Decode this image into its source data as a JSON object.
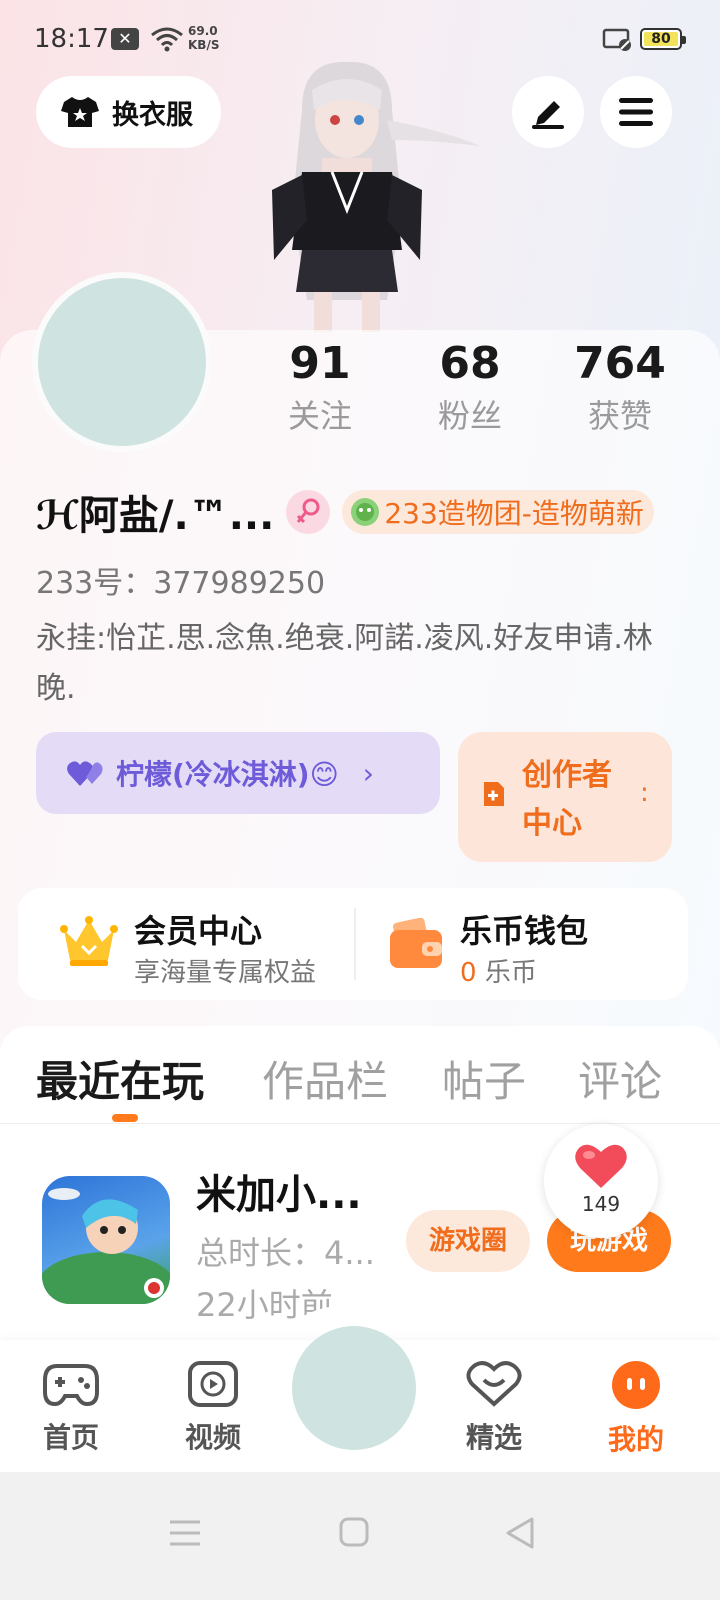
{
  "status_bar": {
    "time": "18:17",
    "network_speed_value": "69.0",
    "network_speed_unit": "KB/S",
    "battery": "80"
  },
  "header": {
    "outfit_label": "换衣服",
    "edit_icon": "pencil-icon",
    "menu_icon": "hamburger-menu-icon"
  },
  "stats": [
    {
      "value": "91",
      "label": "关注"
    },
    {
      "value": "68",
      "label": "粉丝"
    },
    {
      "value": "764",
      "label": "获赞"
    }
  ],
  "profile": {
    "name": "ℋ阿盐/.™...",
    "gender_icon": "female-icon",
    "group_tag": "233造物团-造物萌新",
    "uid": "233号：377989250",
    "bio": "永挂:怡芷.思.念魚.绝衰.阿諾.凌风.好友申请.林晚."
  },
  "fan_club": {
    "label": "柠檬(冷冰淇淋)😊",
    "chevron": "›"
  },
  "creator_center": {
    "label": "创作者中心",
    "extra": ":"
  },
  "vip": {
    "title": "会员中心",
    "subtitle": "享海量专属权益"
  },
  "wallet": {
    "title": "乐币钱包",
    "balance": "0",
    "unit": "乐币"
  },
  "tabs": [
    {
      "label": "最近在玩",
      "active": true
    },
    {
      "label": "作品栏",
      "active": false
    },
    {
      "label": "帖子",
      "active": false
    },
    {
      "label": "评论",
      "active": false
    }
  ],
  "recent_game": {
    "title": "米加小...",
    "duration": "总时长：4...",
    "last_played": "22小时前",
    "circle_button": "游戏圈",
    "play_button": "玩游戏"
  },
  "like_float": {
    "count": "149"
  },
  "bottom_nav": [
    {
      "label": "首页",
      "icon": "gamepad-icon",
      "active": false
    },
    {
      "label": "视频",
      "icon": "video-play-icon",
      "active": false
    },
    {
      "label": "精选",
      "icon": "heart-chat-icon",
      "active": false
    },
    {
      "label": "我的",
      "icon": "face-icon",
      "active": true
    }
  ],
  "colors": {
    "accent": "#ff7a1a",
    "purple": "#6d5bd9"
  }
}
